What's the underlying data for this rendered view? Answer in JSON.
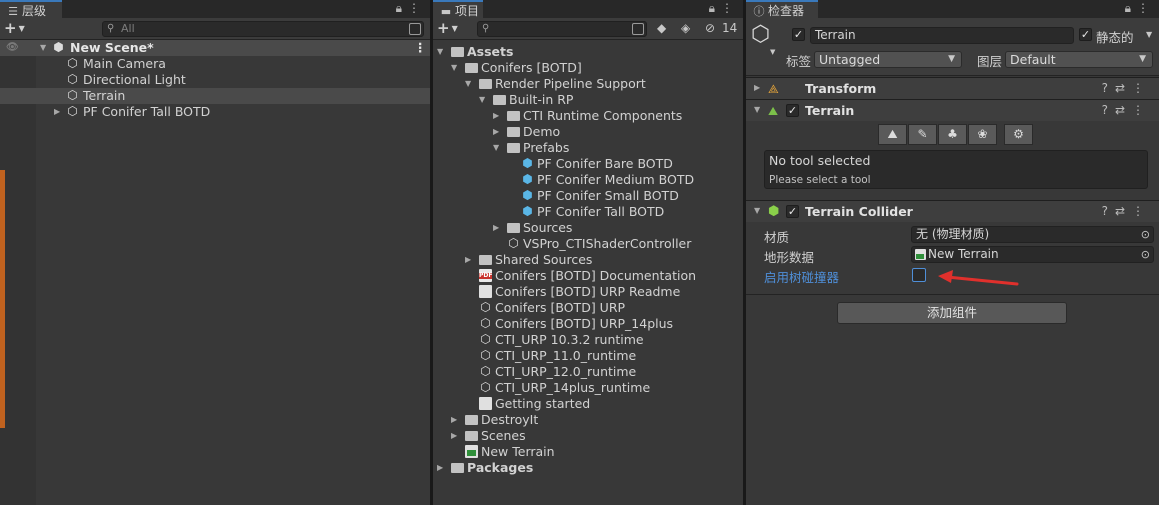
{
  "hierarchy": {
    "tab_label": "层级",
    "tab_icon": "list-icon",
    "search_placeholder": "All",
    "scene_name": "New Scene*",
    "items": [
      {
        "label": "Main Camera"
      },
      {
        "label": "Directional Light"
      },
      {
        "label": "Terrain"
      },
      {
        "label": "PF Conifer Tall BOTD"
      }
    ]
  },
  "project": {
    "tab_label": "项目",
    "tab_icon": "folder-icon",
    "hidden_count": "14",
    "tree": [
      {
        "label": "Assets",
        "type": "folder",
        "expanded": true
      },
      {
        "label": "Conifers [BOTD]",
        "type": "folder",
        "expanded": true
      },
      {
        "label": "Render Pipeline Support",
        "type": "folder",
        "expanded": true
      },
      {
        "label": "Built-in RP",
        "type": "folder",
        "expanded": true
      },
      {
        "label": "CTI Runtime Components",
        "type": "folder",
        "expanded": false
      },
      {
        "label": "Demo",
        "type": "folder",
        "expanded": false
      },
      {
        "label": "Prefabs",
        "type": "folder",
        "expanded": true
      },
      {
        "label": "PF Conifer Bare BOTD",
        "type": "prefab"
      },
      {
        "label": "PF Conifer Medium BOTD",
        "type": "prefab"
      },
      {
        "label": "PF Conifer Small BOTD",
        "type": "prefab"
      },
      {
        "label": "PF Conifer Tall BOTD",
        "type": "prefab"
      },
      {
        "label": "Sources",
        "type": "folder",
        "expanded": false
      },
      {
        "label": "VSPro_CTIShaderController",
        "type": "asset"
      },
      {
        "label": "Shared Sources",
        "type": "folder",
        "expanded": false
      },
      {
        "label": "Conifers [BOTD] Documentation",
        "type": "pdf"
      },
      {
        "label": "Conifers [BOTD] URP Readme",
        "type": "doc"
      },
      {
        "label": "Conifers [BOTD] URP",
        "type": "asset"
      },
      {
        "label": "Conifers [BOTD] URP_14plus",
        "type": "asset"
      },
      {
        "label": "CTI_URP 10.3.2 runtime",
        "type": "asset"
      },
      {
        "label": "CTI_URP_11.0_runtime",
        "type": "asset"
      },
      {
        "label": "CTI_URP_12.0_runtime",
        "type": "asset"
      },
      {
        "label": "CTI_URP_14plus_runtime",
        "type": "asset"
      },
      {
        "label": "Getting started",
        "type": "doc"
      },
      {
        "label": "DestroyIt",
        "type": "folder",
        "expanded": false
      },
      {
        "label": "Scenes",
        "type": "folder",
        "expanded": false
      },
      {
        "label": "New Terrain",
        "type": "terrain"
      },
      {
        "label": "Packages",
        "type": "folder",
        "expanded": false
      }
    ]
  },
  "inspector": {
    "tab_label": "检查器",
    "tab_icon": "info-icon",
    "object_name": "Terrain",
    "static_label": "静态的",
    "tag_label": "标签",
    "tag_value": "Untagged",
    "layer_label": "图层",
    "layer_value": "Default",
    "components": {
      "transform": "Transform",
      "terrain": "Terrain",
      "collider": "Terrain Collider"
    },
    "terrain_tools": [
      "raise-icon",
      "paint-icon",
      "tree-icon",
      "detail-icon",
      "settings-icon"
    ],
    "no_tool_title": "No tool selected",
    "no_tool_hint": "Please select a tool",
    "material_label": "材质",
    "material_value": "无 (物理材质)",
    "terrain_data_label": "地形数据",
    "terrain_data_value": "New Terrain",
    "tree_collider_label": "启用树碰撞器",
    "add_component_label": "添加组件",
    "accent_color": "#4f8fd8",
    "arrow_color": "#e0302c"
  }
}
